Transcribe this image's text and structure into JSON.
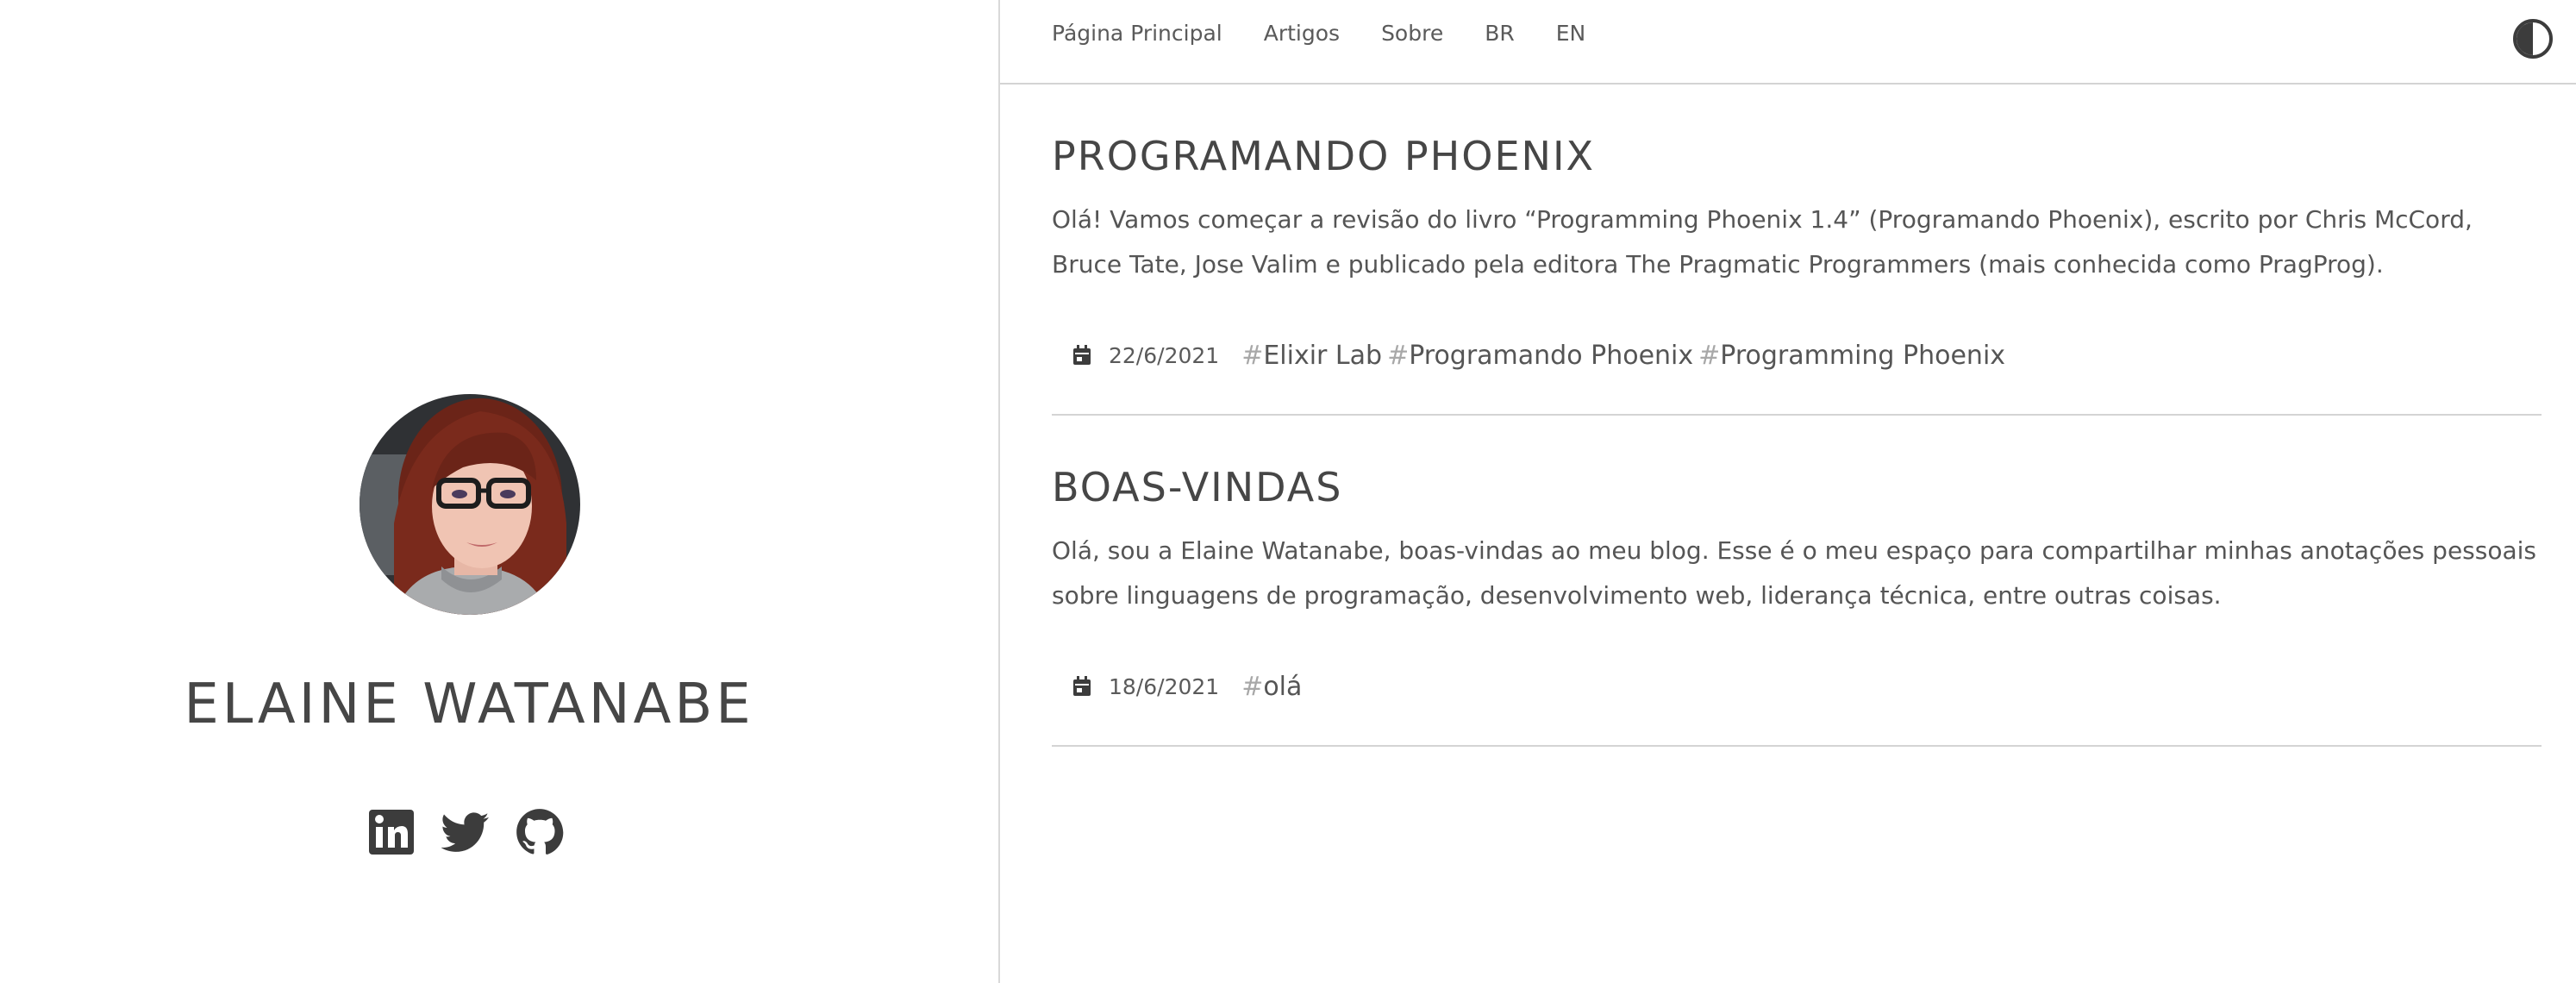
{
  "profile": {
    "name": "ELAINE WATANABE",
    "social": [
      "linkedin-icon",
      "twitter-icon",
      "github-icon"
    ]
  },
  "nav": {
    "items": [
      {
        "label": "Página Principal"
      },
      {
        "label": "Artigos"
      },
      {
        "label": "Sobre"
      },
      {
        "label": "BR"
      },
      {
        "label": "EN"
      }
    ],
    "theme_toggle_icon": "contrast-icon"
  },
  "posts": [
    {
      "title": "PROGRAMANDO PHOENIX",
      "excerpt": "Olá! Vamos começar a revisão do livro “Programming Phoenix 1.4” (Programando Phoenix), escrito por Chris McCord, Bruce Tate, Jose Valim e publicado pela editora The Pragmatic Programmers (mais conhecida como PragProg).",
      "date": "22/6/2021",
      "tags": [
        {
          "hash": "#",
          "label": "Elixir Lab"
        },
        {
          "hash": "#",
          "label": "Programando Phoenix"
        },
        {
          "hash": "#",
          "label": "Programming Phoenix"
        }
      ]
    },
    {
      "title": "BOAS-VINDAS",
      "excerpt": "Olá, sou a Elaine Watanabe, boas-vindas ao meu blog. Esse é o meu espaço para compartilhar minhas anotações pessoais sobre linguagens de programação, desenvolvimento web, liderança técnica, entre outras coisas.",
      "date": "18/6/2021",
      "tags": [
        {
          "hash": "#",
          "label": "olá"
        }
      ]
    }
  ],
  "colors": {
    "text": "#4a4a4a",
    "divider": "#d4d4d4",
    "tag_hash": "#a8a8a8",
    "icon": "#3c3c3c"
  }
}
